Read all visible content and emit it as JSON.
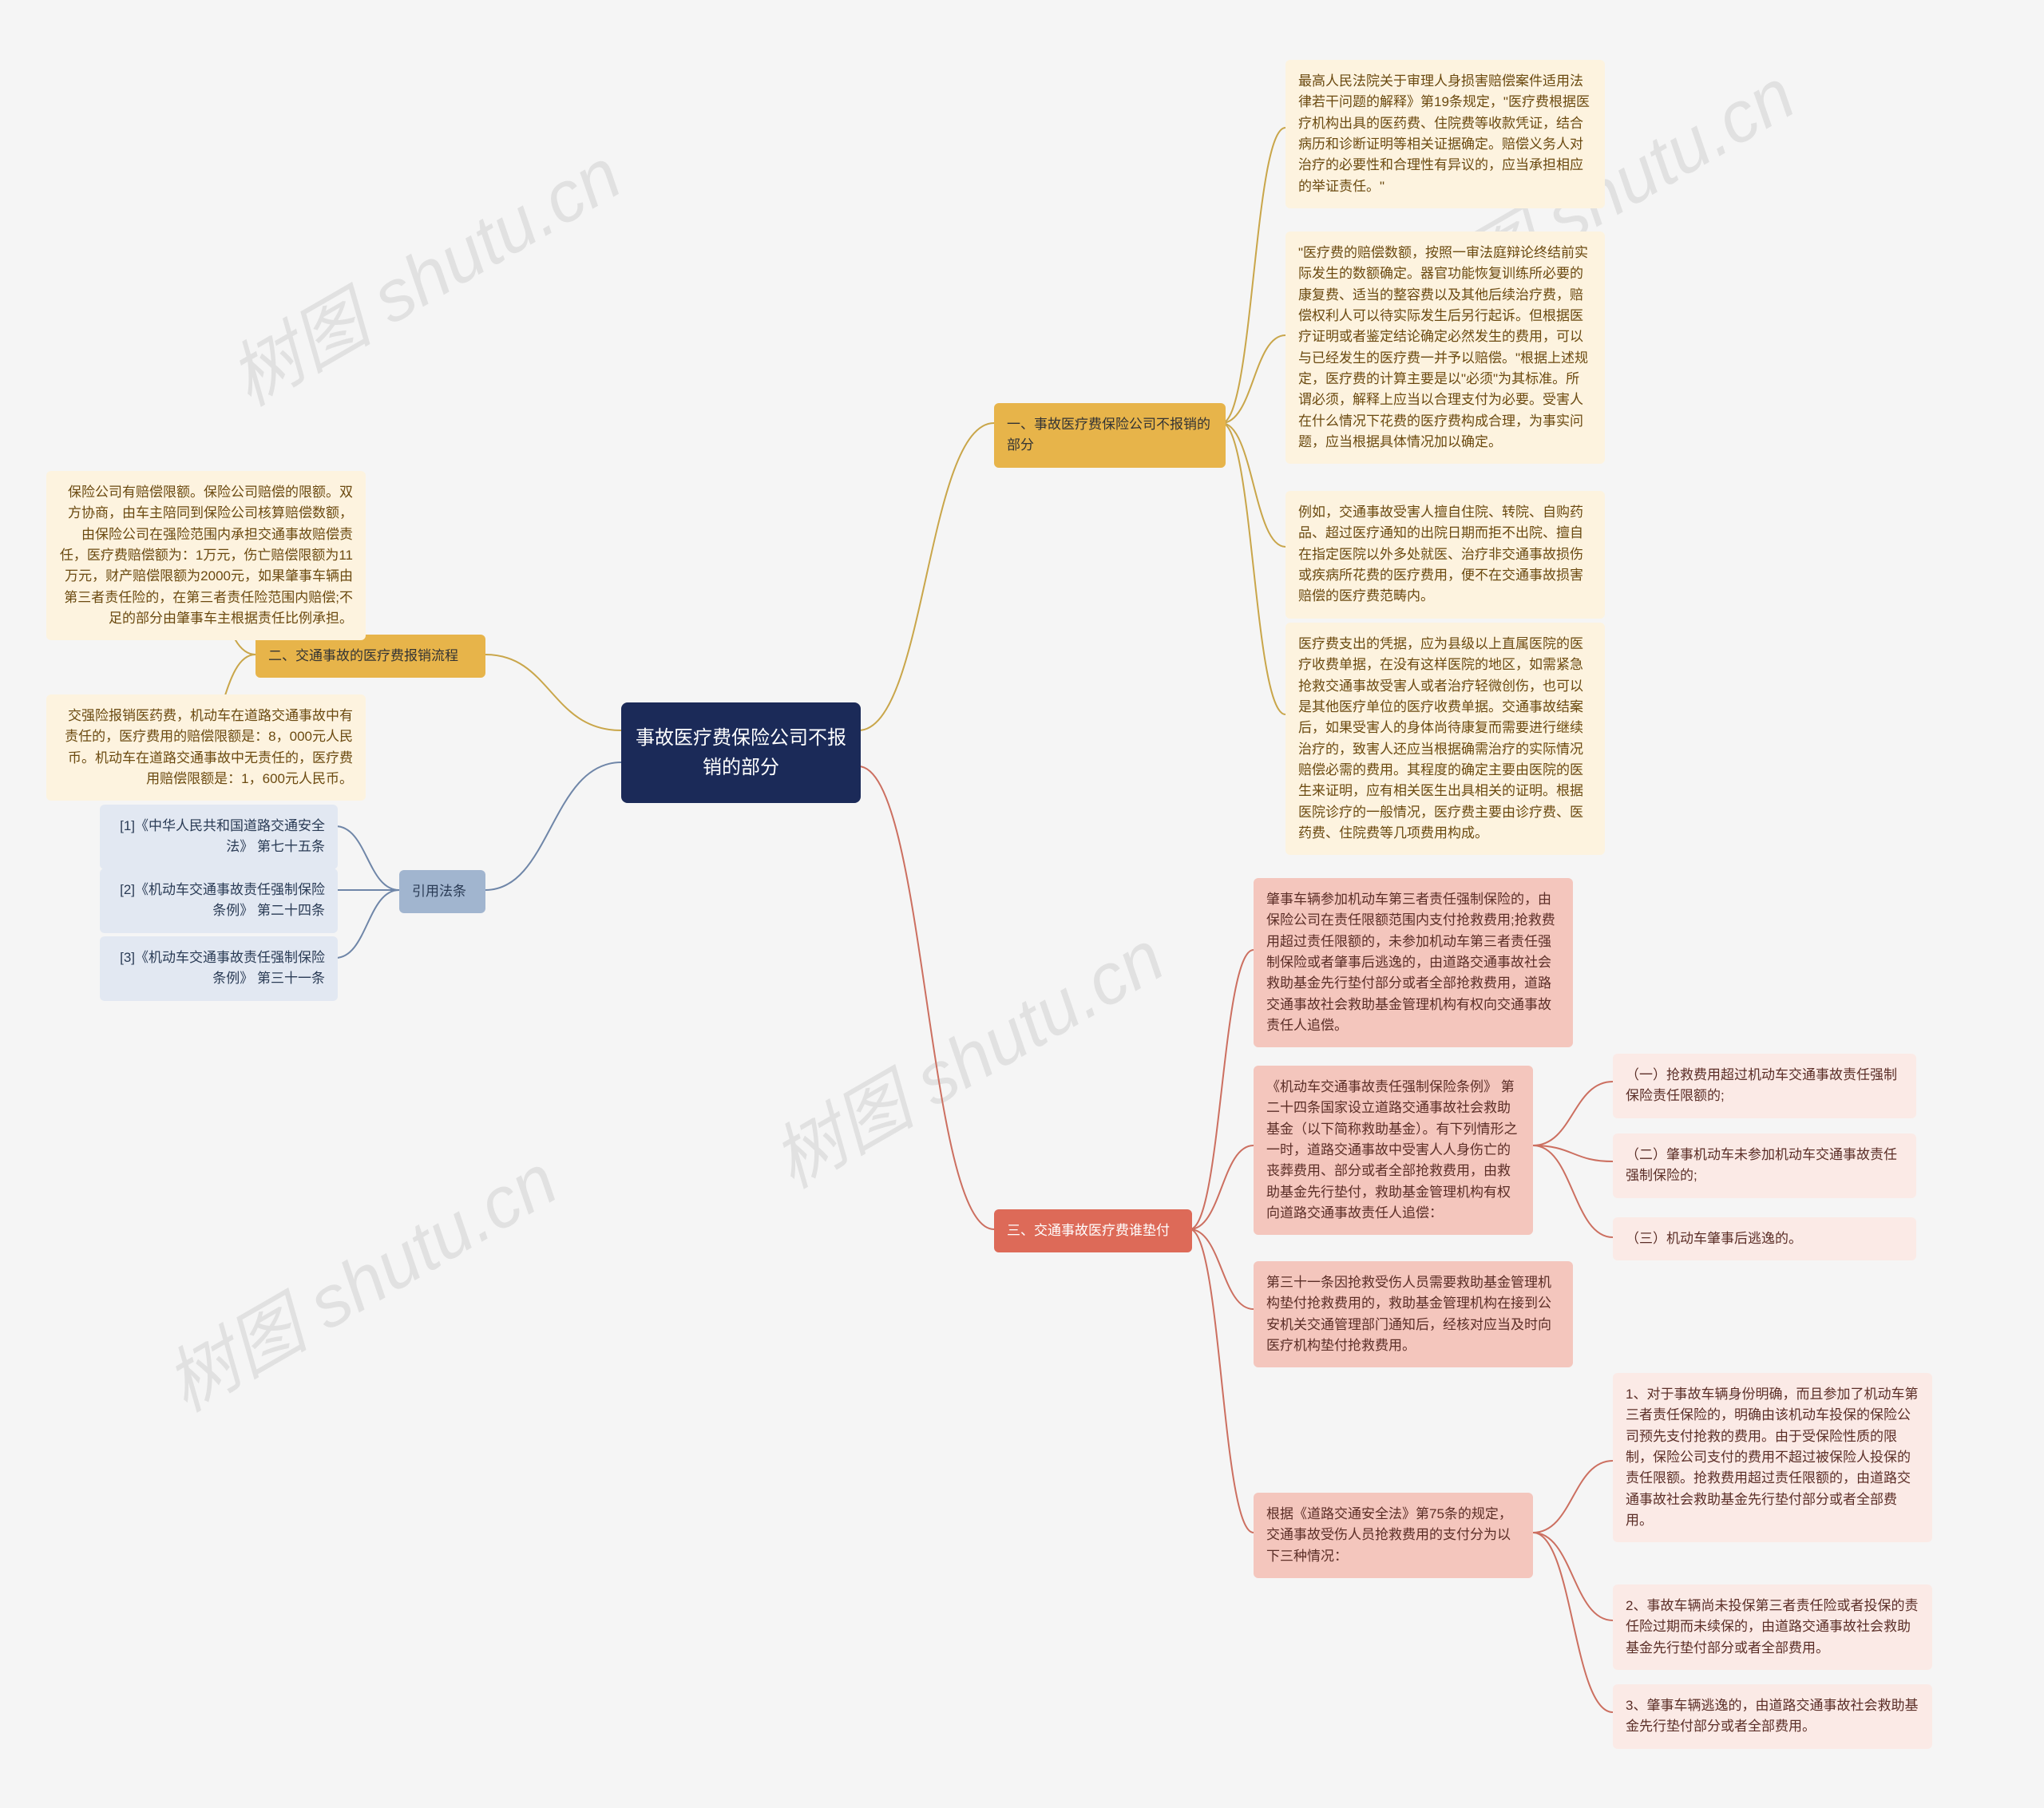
{
  "watermark": "树图 shutu.cn",
  "center": {
    "title": "事故医疗费保险公司不报销的部分"
  },
  "branch1": {
    "title": "一、事故医疗费保险公司不报销的部分",
    "items": [
      "最高人民法院关于审理人身损害赔偿案件适用法律若干问题的解释》第19条规定，\"医疗费根据医疗机构出具的医药费、住院费等收款凭证，结合病历和诊断证明等相关证据确定。赔偿义务人对治疗的必要性和合理性有异议的，应当承担相应的举证责任。\"",
      "\"医疗费的赔偿数额，按照一审法庭辩论终结前实际发生的数额确定。器官功能恢复训练所必要的康复费、适当的整容费以及其他后续治疗费，赔偿权利人可以待实际发生后另行起诉。但根据医疗证明或者鉴定结论确定必然发生的费用，可以与已经发生的医疗费一并予以赔偿。\"根据上述规定，医疗费的计算主要是以\"必须\"为其标准。所谓必须，解释上应当以合理支付为必要。受害人在什么情况下花费的医疗费构成合理，为事实问题，应当根据具体情况加以确定。",
      "例如，交通事故受害人擅自住院、转院、自购药品、超过医疗通知的出院日期而拒不出院、擅自在指定医院以外多处就医、治疗非交通事故损伤或疾病所花费的医疗费用，便不在交通事故损害赔偿的医疗费范畴内。",
      "医疗费支出的凭据，应为县级以上直属医院的医疗收费单据，在没有这样医院的地区，如需紧急抢救交通事故受害人或者治疗轻微创伤，也可以是其他医疗单位的医疗收费单据。交通事故结案后，如果受害人的身体尚待康复而需要进行继续治疗的，致害人还应当根据确需治疗的实际情况赔偿必需的费用。其程度的确定主要由医院的医生来证明，应有相关医生出具相关的证明。根据医院诊疗的一般情况，医疗费主要由诊疗费、医药费、住院费等几项费用构成。"
    ]
  },
  "branch2": {
    "title": "二、交通事故的医疗费报销流程",
    "items": [
      "保险公司有赔偿限额。保险公司赔偿的限额。双方协商，由车主陪同到保险公司核算赔偿数额，由保险公司在强险范围内承担交通事故赔偿责任，医疗费赔偿额为：1万元，伤亡赔偿限额为11万元，财产赔偿限额为2000元，如果肇事车辆由第三者责任险的，在第三者责任险范围内赔偿;不足的部分由肇事车主根据责任比例承担。",
      "交强险报销医药费，机动车在道路交通事故中有责任的，医疗费用的赔偿限额是：8，000元人民币。机动车在道路交通事故中无责任的，医疗费用赔偿限额是：1，600元人民币。"
    ]
  },
  "branch3": {
    "title": "三、交通事故医疗费谁垫付",
    "items": [
      "肇事车辆参加机动车第三者责任强制保险的，由保险公司在责任限额范围内支付抢救费用;抢救费用超过责任限额的，未参加机动车第三者责任强制保险或者肇事后逃逸的，由道路交通事故社会救助基金先行垫付部分或者全部抢救费用，道路交通事故社会救助基金管理机构有权向交通事故责任人追偿。",
      "《机动车交通事故责任强制保险条例》 第二十四条国家设立道路交通事故社会救助基金（以下简称救助基金）。有下列情形之一时，道路交通事故中受害人人身伤亡的丧葬费用、部分或者全部抢救费用，由救助基金先行垫付，救助基金管理机构有权向道路交通事故责任人追偿：",
      "第三十一条因抢救受伤人员需要救助基金管理机构垫付抢救费用的，救助基金管理机构在接到公安机关交通管理部门通知后，经核对应当及时向医疗机构垫付抢救费用。",
      "根据《道路交通安全法》第75条的规定，交通事故受伤人员抢救费用的支付分为以下三种情况："
    ],
    "sub_a": [
      "（一）抢救费用超过机动车交通事故责任强制保险责任限额的;",
      "（二）肇事机动车未参加机动车交通事故责任强制保险的;",
      "（三）机动车肇事后逃逸的。"
    ],
    "sub_b": [
      "1、对于事故车辆身份明确，而且参加了机动车第三者责任保险的，明确由该机动车投保的保险公司预先支付抢救的费用。由于受保险性质的限制，保险公司支付的费用不超过被保险人投保的责任限额。抢救费用超过责任限额的，由道路交通事故社会救助基金先行垫付部分或者全部费用。",
      "2、事故车辆尚未投保第三者责任险或者投保的责任险过期而未续保的，由道路交通事故社会救助基金先行垫付部分或者全部费用。",
      "3、肇事车辆逃逸的，由道路交通事故社会救助基金先行垫付部分或者全部费用。"
    ]
  },
  "branch_law": {
    "title": "引用法条",
    "items": [
      "[1]《中华人民共和国道路交通安全法》 第七十五条",
      "[2]《机动车交通事故责任强制保险条例》 第二十四条",
      "[3]《机动车交通事故责任强制保险条例》 第三十一条"
    ]
  },
  "chart_data": {
    "type": "mindmap",
    "root": "事故医疗费保险公司不报销的部分",
    "direction": "both",
    "branches": [
      {
        "side": "right",
        "label": "一、事故医疗费保险公司不报销的部分",
        "children": [
          "最高人民法院关于审理人身损害赔偿案件适用法律若干问题的解释》第19条规定…应当承担相应的举证责任。",
          "医疗费的赔偿数额，按照一审法庭辩论终结前实际发生的数额确定…应当根据具体情况加以确定。",
          "例如，交通事故受害人擅自住院、转院…便不在交通事故损害赔偿的医疗费范畴内。",
          "医疗费支出的凭据，应为县级以上直属医院的医疗收费单据…主要由诊疗费、医药费、住院费等几项费用构成。"
        ]
      },
      {
        "side": "right",
        "label": "三、交通事故医疗费谁垫付",
        "children": [
          "肇事车辆参加机动车第三者责任强制保险的，由保险公司在责任限额范围内支付抢救费用…有权向交通事故责任人追偿。",
          {
            "label": "《机动车交通事故责任强制保险条例》 第二十四条国家设立道路交通事故社会救助基金…追偿：",
            "children": [
              "（一）抢救费用超过机动车交通事故责任强制保险责任限额的;",
              "（二）肇事机动车未参加机动车交通事故责任强制保险的;",
              "（三）机动车肇事后逃逸的。"
            ]
          },
          "第三十一条因抢救受伤人员需要救助基金管理机构垫付抢救费用的…及时向医疗机构垫付抢救费用。",
          {
            "label": "根据《道路交通安全法》第75条的规定，交通事故受伤人员抢救费用的支付分为以下三种情况：",
            "children": [
              "1、对于事故车辆身份明确，而且参加了机动车第三者责任保险的…先行垫付部分或者全部费用。",
              "2、事故车辆尚未投保第三者责任险或者投保的责任险过期而未续保的…先行垫付部分或者全部费用。",
              "3、肇事车辆逃逸的，由道路交通事故社会救助基金先行垫付部分或者全部费用。"
            ]
          }
        ]
      },
      {
        "side": "left",
        "label": "二、交通事故的医疗费报销流程",
        "children": [
          "保险公司有赔偿限额。保险公司赔偿的限额。双方协商…不足的部分由肇事车主根据责任比例承担。",
          "交强险报销医药费，机动车在道路交通事故中有责任的，医疗费用的赔偿限额是：8，000元人民币…无责任的，医疗费用赔偿限额是：1，600元人民币。"
        ]
      },
      {
        "side": "left",
        "label": "引用法条",
        "children": [
          "[1]《中华人民共和国道路交通安全法》 第七十五条",
          "[2]《机动车交通事故责任强制保险条例》 第二十四条",
          "[3]《机动车交通事故责任强制保险条例》 第三十一条"
        ]
      }
    ]
  }
}
